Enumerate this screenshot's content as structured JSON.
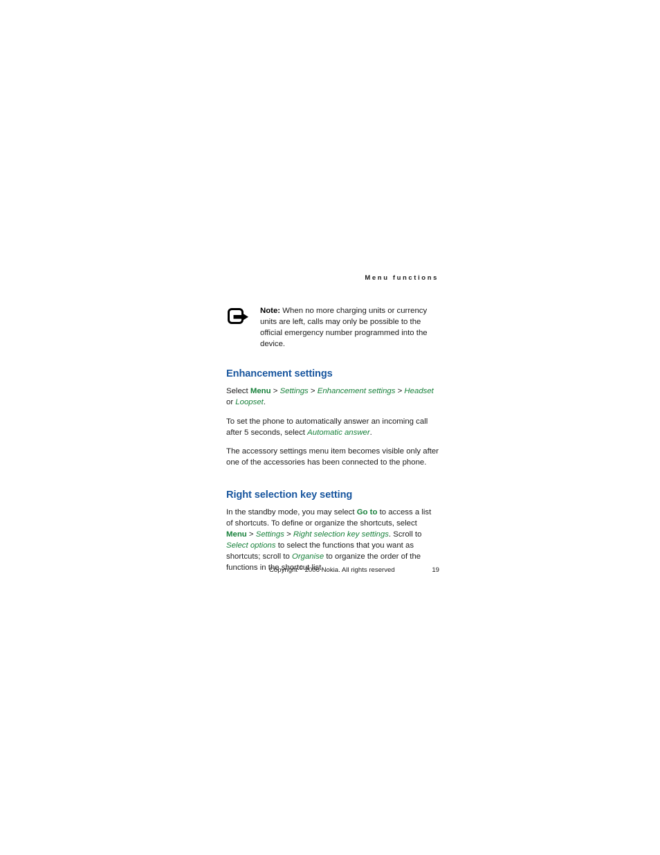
{
  "running_header": "Menu functions",
  "note": {
    "icon": "note-pointer-icon",
    "label": "Note:",
    "text": " When no more charging units or currency units are left, calls may only be possible to the official emergency number programmed into the device."
  },
  "sections": [
    {
      "heading": "Enhancement settings",
      "paragraphs": [
        {
          "runs": [
            {
              "text": "Select ",
              "style": "plain"
            },
            {
              "text": "Menu",
              "style": "menu-bold"
            },
            {
              "text": " > ",
              "style": "sep"
            },
            {
              "text": "Settings",
              "style": "menu-italic"
            },
            {
              "text": " > ",
              "style": "sep"
            },
            {
              "text": "Enhancement settings",
              "style": "menu-italic"
            },
            {
              "text": " > ",
              "style": "sep"
            },
            {
              "text": "Headset",
              "style": "menu-italic"
            },
            {
              "text": " or ",
              "style": "plain"
            },
            {
              "text": "Loopset",
              "style": "menu-italic"
            },
            {
              "text": ".",
              "style": "plain"
            }
          ]
        },
        {
          "runs": [
            {
              "text": "To set the phone to automatically answer an incoming call after 5 seconds, select ",
              "style": "plain"
            },
            {
              "text": "Automatic answer",
              "style": "menu-italic"
            },
            {
              "text": ".",
              "style": "plain"
            }
          ]
        },
        {
          "runs": [
            {
              "text": "The accessory settings menu item becomes visible only after one of the accessories has been connected to the phone.",
              "style": "plain"
            }
          ]
        }
      ]
    },
    {
      "heading": "Right selection key setting",
      "paragraphs": [
        {
          "runs": [
            {
              "text": "In the standby mode, you may select ",
              "style": "plain"
            },
            {
              "text": "Go to",
              "style": "menu-bold"
            },
            {
              "text": " to access a list of shortcuts. To define or organize the shortcuts, select ",
              "style": "plain"
            },
            {
              "text": "Menu",
              "style": "menu-bold"
            },
            {
              "text": " > ",
              "style": "sep"
            },
            {
              "text": "Settings",
              "style": "menu-italic"
            },
            {
              "text": " > ",
              "style": "sep"
            },
            {
              "text": "Right selection key settings",
              "style": "menu-italic"
            },
            {
              "text": ". Scroll to ",
              "style": "plain"
            },
            {
              "text": "Select options",
              "style": "menu-italic"
            },
            {
              "text": " to select the functions that you want as shortcuts; scroll to ",
              "style": "plain"
            },
            {
              "text": "Organise",
              "style": "menu-italic"
            },
            {
              "text": " to organize the order of the functions in the shortcut list.",
              "style": "plain"
            }
          ]
        }
      ]
    }
  ],
  "footer": {
    "copyright_pre": "Copyright ",
    "copyright_symbol": "©",
    "copyright_post": " 2006 Nokia. All rights reserved",
    "page_number": "19"
  },
  "colors": {
    "heading_blue": "#17559e",
    "menu_green": "#17803a",
    "body_text": "#1a1a1a"
  }
}
